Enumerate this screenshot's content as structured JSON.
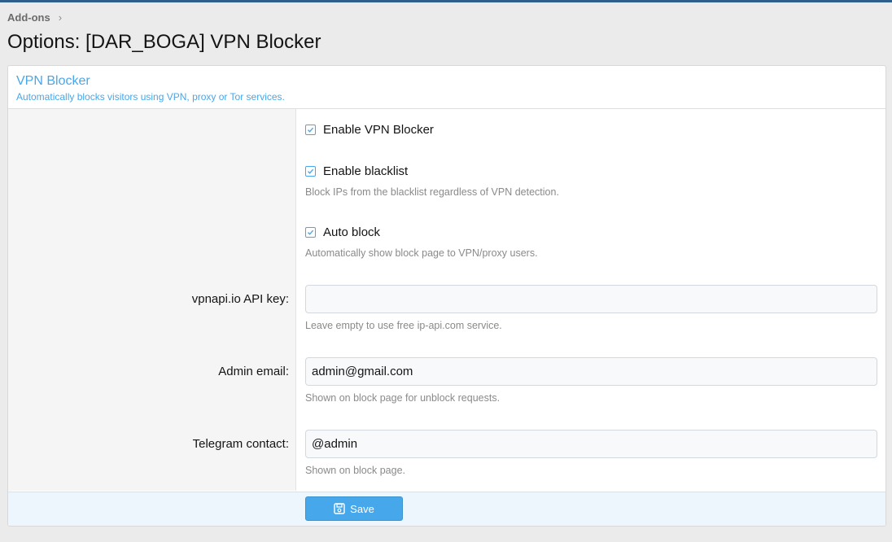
{
  "breadcrumb": {
    "item": "Add-ons",
    "separator": "›"
  },
  "page": {
    "title": "Options: [DAR_BOGA] VPN Blocker"
  },
  "block": {
    "title": "VPN Blocker",
    "description": "Automatically blocks visitors using VPN, proxy or Tor services."
  },
  "options": {
    "enable_vpn_blocker": {
      "label": "Enable VPN Blocker",
      "checked": true
    },
    "enable_blacklist": {
      "label": "Enable blacklist",
      "checked": true,
      "hint": "Block IPs from the blacklist regardless of VPN detection."
    },
    "auto_block": {
      "label": "Auto block",
      "checked": true,
      "hint": "Automatically show block page to VPN/proxy users."
    },
    "api_key": {
      "label": "vpnapi.io API key:",
      "value": "",
      "hint": "Leave empty to use free ip-api.com service."
    },
    "admin_email": {
      "label": "Admin email:",
      "value": "admin@gmail.com",
      "hint": "Shown on block page for unblock requests."
    },
    "telegram_contact": {
      "label": "Telegram contact:",
      "value": "@admin",
      "hint": "Shown on block page."
    }
  },
  "footer": {
    "save_label": "Save",
    "save_icon": "save-icon"
  },
  "colors": {
    "accent": "#47a7eb",
    "top_bar": "#2f5f8c"
  }
}
